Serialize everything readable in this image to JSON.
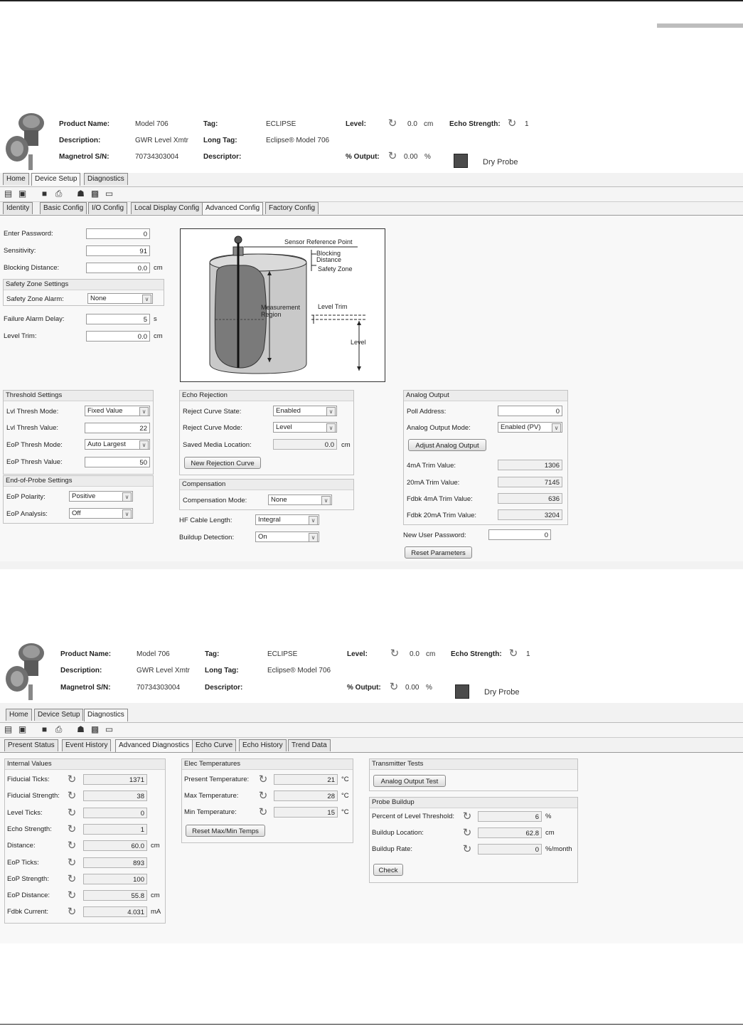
{
  "header": {
    "product_name_label": "Product Name:",
    "product_name": "Model 706",
    "description_label": "Description:",
    "description": "GWR Level Xmtr",
    "serial_label": "Magnetrol S/N:",
    "serial": "70734303004",
    "tag_label": "Tag:",
    "tag": "ECLIPSE",
    "long_tag_label": "Long Tag:",
    "long_tag": "Eclipse® Model 706",
    "descriptor_label": "Descriptor:",
    "descriptor": "",
    "level_label": "Level:",
    "level_value": "0.0",
    "level_unit": "cm",
    "output_label": "% Output:",
    "output_value": "0.00",
    "output_unit": "%",
    "echo_label": "Echo Strength:",
    "echo_value": "1",
    "status": "Dry Probe"
  },
  "main_tabs": [
    "Home",
    "Device Setup",
    "Diagnostics"
  ],
  "toolbar_icons": [
    "window-icon",
    "windows-icon",
    "save-icon",
    "print-icon",
    "device-icon",
    "image-icon",
    "panel-icon"
  ],
  "screen1": {
    "sub_tabs": [
      "Identity",
      "Basic Config",
      "I/O Config",
      "Local Display Config",
      "Advanced Config",
      "Factory Config"
    ],
    "enter_password_label": "Enter Password:",
    "enter_password": "0",
    "sensitivity_label": "Sensitivity:",
    "sensitivity": "91",
    "blocking_label": "Blocking Distance:",
    "blocking": "0.0",
    "unit_cm": "cm",
    "safety_group": "Safety Zone Settings",
    "safety_alarm_label": "Safety Zone Alarm:",
    "safety_alarm": "None",
    "failure_delay_label": "Failure Alarm Delay:",
    "failure_delay": "5",
    "unit_s": "s",
    "level_trim_label": "Level Trim:",
    "level_trim": "0.0",
    "diagram": {
      "sensor_ref": "Sensor Reference Point",
      "blocking": "Blocking",
      "distance": "Distance",
      "safety_zone": "Safety Zone",
      "measurement": "Measurement",
      "region": "Region",
      "level_trim": "Level Trim",
      "level": "Level"
    },
    "threshold_group": "Threshold Settings",
    "lvl_mode_label": "Lvl Thresh Mode:",
    "lvl_mode": "Fixed Value",
    "lvl_value_label": "Lvl Thresh Value:",
    "lvl_value": "22",
    "eop_mode_label": "EoP Thresh Mode:",
    "eop_mode": "Auto Largest",
    "eop_value_label": "EoP Thresh Value:",
    "eop_value": "50",
    "eop_group": "End-of-Probe Settings",
    "eop_polarity_label": "EoP Polarity:",
    "eop_polarity": "Positive",
    "eop_analysis_label": "EoP Analysis:",
    "eop_analysis": "Off",
    "echo_group": "Echo Rejection",
    "reject_state_label": "Reject Curve State:",
    "reject_state": "Enabled",
    "reject_mode_label": "Reject Curve Mode:",
    "reject_mode": "Level",
    "saved_media_label": "Saved Media Location:",
    "saved_media": "0.0",
    "new_rejection_btn": "New Rejection Curve",
    "comp_group": "Compensation",
    "comp_mode_label": "Compensation Mode:",
    "comp_mode": "None",
    "hf_label": "HF Cable Length:",
    "hf": "Integral",
    "buildup_label": "Buildup Detection:",
    "buildup": "On",
    "analog_group": "Analog Output",
    "poll_label": "Poll Address:",
    "poll": "0",
    "analog_mode_label": "Analog Output Mode:",
    "analog_mode": "Enabled (PV)",
    "adjust_btn": "Adjust Analog Output",
    "trim4_label": "4mA Trim Value:",
    "trim4": "1306",
    "trim20_label": "20mA Trim Value:",
    "trim20": "7145",
    "fdbk4_label": "Fdbk 4mA Trim Value:",
    "fdbk4": "636",
    "fdbk20_label": "Fdbk 20mA Trim Value:",
    "fdbk20": "3204",
    "new_pw_label": "New User Password:",
    "new_pw": "0",
    "reset_btn": "Reset Parameters"
  },
  "screen2": {
    "sub_tabs": [
      "Present Status",
      "Event History",
      "Advanced Diagnostics",
      "Echo Curve",
      "Echo History",
      "Trend Data"
    ],
    "internal_group": "Internal Values",
    "internal": [
      {
        "label": "Fiducial Ticks:",
        "value": "1371",
        "unit": ""
      },
      {
        "label": "Fiducial Strength:",
        "value": "38",
        "unit": ""
      },
      {
        "label": "Level Ticks:",
        "value": "0",
        "unit": ""
      },
      {
        "label": "Echo Strength:",
        "value": "1",
        "unit": ""
      },
      {
        "label": "Distance:",
        "value": "60.0",
        "unit": "cm"
      },
      {
        "label": "EoP Ticks:",
        "value": "893",
        "unit": ""
      },
      {
        "label": "EoP Strength:",
        "value": "100",
        "unit": ""
      },
      {
        "label": "EoP Distance:",
        "value": "55.8",
        "unit": "cm"
      },
      {
        "label": "Fdbk Current:",
        "value": "4.031",
        "unit": "mA"
      }
    ],
    "temps_group": "Elec Temperatures",
    "temps": [
      {
        "label": "Present Temperature:",
        "value": "21",
        "unit": "°C"
      },
      {
        "label": "Max Temperature:",
        "value": "28",
        "unit": "°C"
      },
      {
        "label": "Min Temperature:",
        "value": "15",
        "unit": "°C"
      }
    ],
    "reset_temps_btn": "Reset Max/Min Temps",
    "tx_group": "Transmitter Tests",
    "aot_btn": "Analog Output Test",
    "probe_group": "Probe Buildup",
    "probe": [
      {
        "label": "Percent of Level Threshold:",
        "value": "6",
        "unit": "%"
      },
      {
        "label": "Buildup Location:",
        "value": "62.8",
        "unit": "cm"
      },
      {
        "label": "Buildup Rate:",
        "value": "0",
        "unit": "%/month"
      }
    ],
    "check_btn": "Check"
  }
}
